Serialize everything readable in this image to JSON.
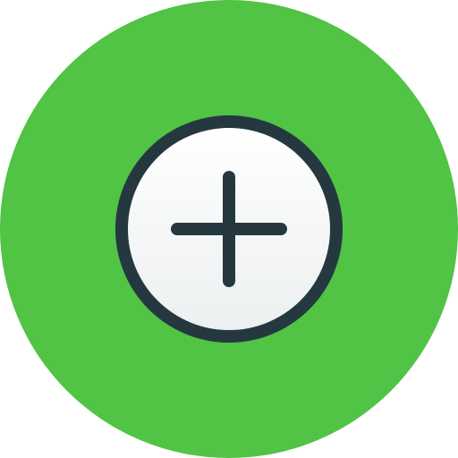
{
  "icon": {
    "name": "add-icon",
    "glyph": "plus",
    "colors": {
      "background_circle": "#51C345",
      "inner_circle_fill": "#F3F5F5",
      "inner_circle_stroke": "#253840",
      "plus": "#253840"
    }
  }
}
